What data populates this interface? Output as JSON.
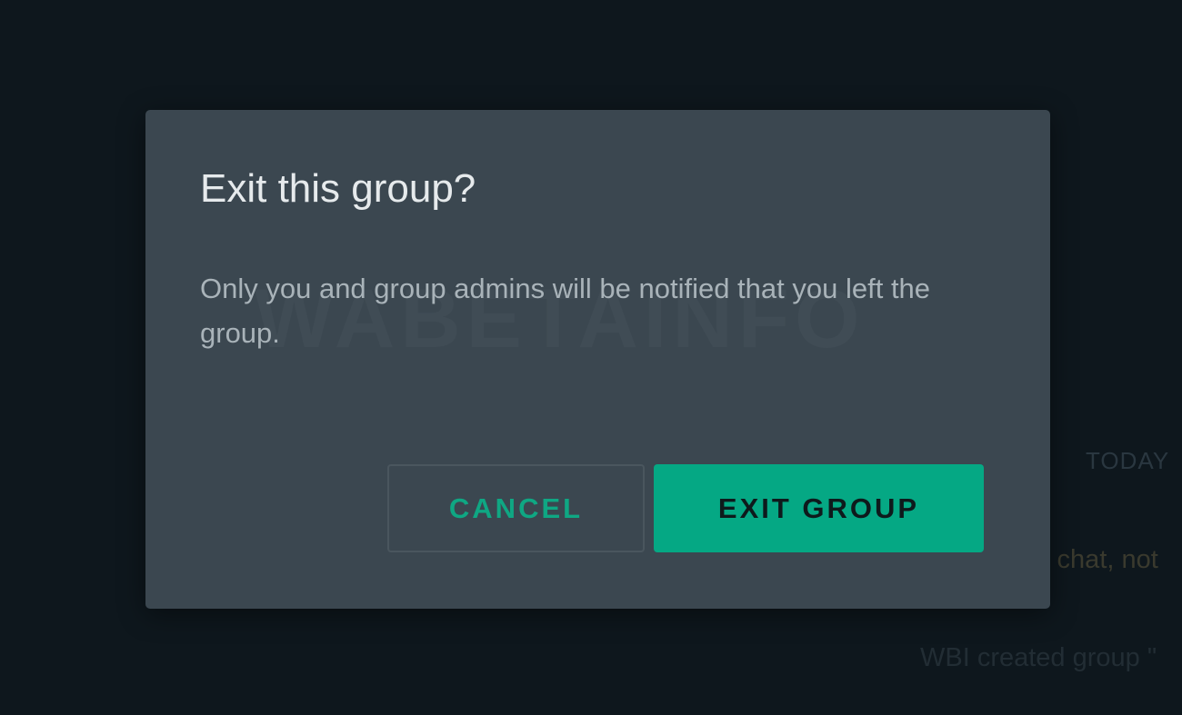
{
  "background": {
    "date_label": "TODAY",
    "chat_fragment": "s chat, not",
    "system_message": "WBI created group \""
  },
  "dialog": {
    "watermark": "WABETAINFO",
    "title": "Exit this group?",
    "message": "Only you and group admins will be notified that you left the group.",
    "cancel_label": "CANCEL",
    "confirm_label": "EXIT GROUP"
  },
  "colors": {
    "accent": "#05a884",
    "dialog_bg": "#3b4750",
    "backdrop": "#0e171d"
  }
}
